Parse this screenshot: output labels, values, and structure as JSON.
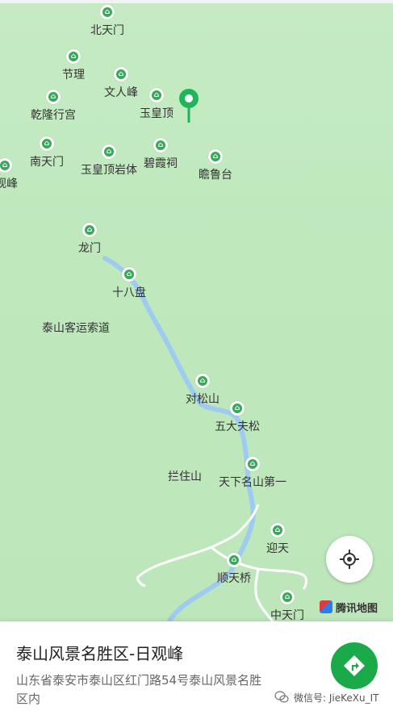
{
  "map": {
    "pois": [
      {
        "name": "北天门"
      },
      {
        "name": "节理"
      },
      {
        "name": "文人峰"
      },
      {
        "name": "玉皇顶"
      },
      {
        "name": "乾隆行宫"
      },
      {
        "name": "南天门"
      },
      {
        "name": "玉皇顶岩体"
      },
      {
        "name": "碧霞祠"
      },
      {
        "name": "瞻鲁台"
      },
      {
        "name": "观峰"
      },
      {
        "name": "龙门"
      },
      {
        "name": "十八盘"
      },
      {
        "name": "对松山"
      },
      {
        "name": "五大夫松"
      },
      {
        "name": "天下名山第一"
      },
      {
        "name": "迎天"
      },
      {
        "name": "顺天桥"
      },
      {
        "name": "中天门"
      }
    ],
    "labels": {
      "cableway": "泰山客运索道",
      "lanzhu": "拦住山"
    },
    "brand": "腾讯地图",
    "colors": {
      "land": "#c6ebc3",
      "river": "#9ecbf0",
      "poi": "#3aa85a",
      "selected_pin": "#1fb55a"
    },
    "icons": {
      "poi": "scenic-spot-icon",
      "selected": "location-pin-icon",
      "locate": "locate-crosshair-icon",
      "navigate": "navigation-icon"
    }
  },
  "place": {
    "title": "泰山风景名胜区-日观峰",
    "address": "山东省泰安市泰山区红门路54号泰山风景名胜区内"
  },
  "watermark": "微信号: JieKeXu_IT"
}
